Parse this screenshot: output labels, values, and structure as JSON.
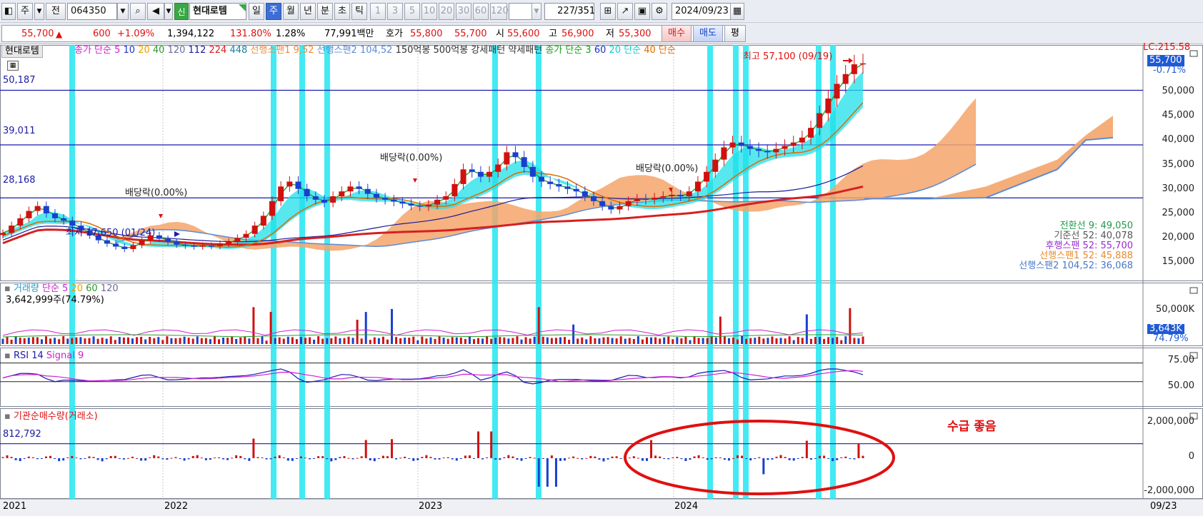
{
  "toolbar": {
    "period_btn": "주",
    "prev_btn": "전",
    "code": "064350",
    "credit_tag": "신",
    "stock_name": "현대로템",
    "periods": [
      "일",
      "주",
      "월",
      "년",
      "분",
      "초",
      "틱"
    ],
    "selected_period": "주",
    "num_btns": [
      "1",
      "3",
      "5",
      "10",
      "20",
      "30",
      "60",
      "120"
    ],
    "count": "227",
    "total": "/351",
    "date": "2024/09/23"
  },
  "quote": {
    "price": "55,700",
    "arrow": "▲",
    "change": "600",
    "change_pct": "+1.09%",
    "volume": "1,394,122",
    "volume_ratio": "131.80%",
    "turnover": "1.28%",
    "amount": "77,991백만",
    "ask_label": "호가",
    "ask": "55,800",
    "bid": "55,700",
    "open_label": "시",
    "open": "55,600",
    "high_label": "고",
    "high": "56,900",
    "low_label": "저",
    "low": "55,300",
    "buy_btn": "매수",
    "sell_btn": "매도",
    "eval_btn": "평"
  },
  "price_panel": {
    "stock_label": "현대로템",
    "legend": [
      {
        "text": "종가 단순 5",
        "color": "#d01fd0"
      },
      {
        "text": "10",
        "color": "#1a33c9"
      },
      {
        "text": "20",
        "color": "#e8a000"
      },
      {
        "text": "40",
        "color": "#2c9b2c"
      },
      {
        "text": "120",
        "color": "#6a6a9a"
      },
      {
        "text": "112",
        "color": "#1a1a9a"
      },
      {
        "text": "224",
        "color": "#d62020"
      },
      {
        "text": "448",
        "color": "#1e7fa0"
      },
      {
        "text": "선행스팬1 9,52",
        "color": "#f08a3c"
      },
      {
        "text": "선행스팬2 104,52",
        "color": "#5b8cd8"
      },
      {
        "text": "150억봉",
        "color": "#333"
      },
      {
        "text": "500억봉",
        "color": "#333"
      },
      {
        "text": "강세패턴",
        "color": "#333"
      },
      {
        "text": "약세패턴",
        "color": "#333"
      },
      {
        "text": "종가 단순 3",
        "color": "#1aa01a"
      },
      {
        "text": "60",
        "color": "#1a33c9"
      },
      {
        "text": "20 단순",
        "color": "#19c9c9"
      },
      {
        "text": "40 단순",
        "color": "#e06a00"
      }
    ],
    "hlines": [
      {
        "label": "50,187",
        "value": 50187
      },
      {
        "label": "39,011",
        "value": 39011
      },
      {
        "label": "28,168",
        "value": 28168
      }
    ],
    "annotations": {
      "div1": "배당락(0.00%)",
      "div2": "배당락(0.00%)",
      "div3": "배당락(0.00%)",
      "high": "최고 57,100 (09/19)",
      "low": "최저 17,650 (01/24)"
    },
    "price_tag": "55,700",
    "pct_tag": "-0.71%",
    "lc_label": "LC:215.58",
    "y_ticks": [
      "50,000",
      "45,000",
      "40,000",
      "35,000",
      "30,000",
      "25,000",
      "20,000",
      "15,000"
    ],
    "ichimoku_labels": [
      {
        "text": "전환선 9: 49,050",
        "color": "#1f9a4a"
      },
      {
        "text": "기준선 52: 40,078",
        "color": "#555555"
      },
      {
        "text": "후행스팬 52: 55,700",
        "color": "#9a2bd0"
      },
      {
        "text": "선행스팬1 52: 45,888",
        "color": "#e88a30"
      },
      {
        "text": "선행스팬2 104,52: 36,068",
        "color": "#4a78c8"
      }
    ]
  },
  "volume_panel": {
    "legend_title": "거래량",
    "legend_ma": [
      {
        "text": "단순 5",
        "color": "#d01fd0"
      },
      {
        "text": "20",
        "color": "#e8a000"
      },
      {
        "text": "60",
        "color": "#2c9b2c"
      },
      {
        "text": "120",
        "color": "#6a6a9a"
      }
    ],
    "current": "3,642,999주(74.79%)",
    "y_tick": "50,000K",
    "tag": "3,643K",
    "tag_pct": "74.79%"
  },
  "rsi_panel": {
    "label_rsi": "RSI 14",
    "label_signal": "Signal 9",
    "y_ticks": [
      "75.00",
      "50.00"
    ]
  },
  "inst_panel": {
    "label": "기관순매수량(거래소)",
    "ref_value": "812,792",
    "y_ticks": [
      "2,000,000",
      "0",
      "-2,000,000"
    ],
    "note": "수급 좋음"
  },
  "x_axis": {
    "labels": [
      "2021",
      "2022",
      "2023",
      "2024"
    ],
    "right_label": "09/23"
  },
  "chart_data": {
    "type": "candlestick",
    "x_range": [
      "2021-01",
      "2024-09"
    ],
    "price_ylim": [
      12000,
      58000
    ],
    "closes": [
      21000,
      22500,
      24000,
      25500,
      26500,
      25000,
      24000,
      23500,
      22500,
      21500,
      20500,
      19500,
      18800,
      18200,
      17700,
      18500,
      19500,
      20500,
      19800,
      19200,
      18600,
      18400,
      18200,
      18400,
      18300,
      18800,
      19200,
      20000,
      20800,
      22500,
      24500,
      27500,
      30500,
      31500,
      30000,
      28500,
      27800,
      27200,
      28500,
      29500,
      30500,
      30000,
      29000,
      28200,
      27800,
      27400,
      27000,
      26600,
      26400,
      26800,
      27800,
      28500,
      31000,
      34000,
      33500,
      32500,
      33500,
      35000,
      37500,
      36500,
      34500,
      32500,
      31500,
      31000,
      30500,
      30000,
      29500,
      28500,
      27500,
      26500,
      25800,
      26500,
      27500,
      28000,
      27800,
      28200,
      28500,
      28800,
      28500,
      29500,
      31500,
      33500,
      36000,
      38500,
      39500,
      38800,
      38200,
      37800,
      37500,
      38200,
      38800,
      39500,
      40500,
      42500,
      45500,
      48500,
      51500,
      53500,
      55500,
      55700
    ],
    "hlines": [
      50187,
      39011,
      28168
    ],
    "ichimoku_latest": {
      "conversion_9": 49050,
      "base_52": 40078,
      "lagging_52": 55700,
      "leading1_52": 45888,
      "leading2_104_52": 36068
    },
    "volume_current": 3642999,
    "inst_net_ref": 812792,
    "rsi_levels": [
      75,
      50
    ]
  }
}
